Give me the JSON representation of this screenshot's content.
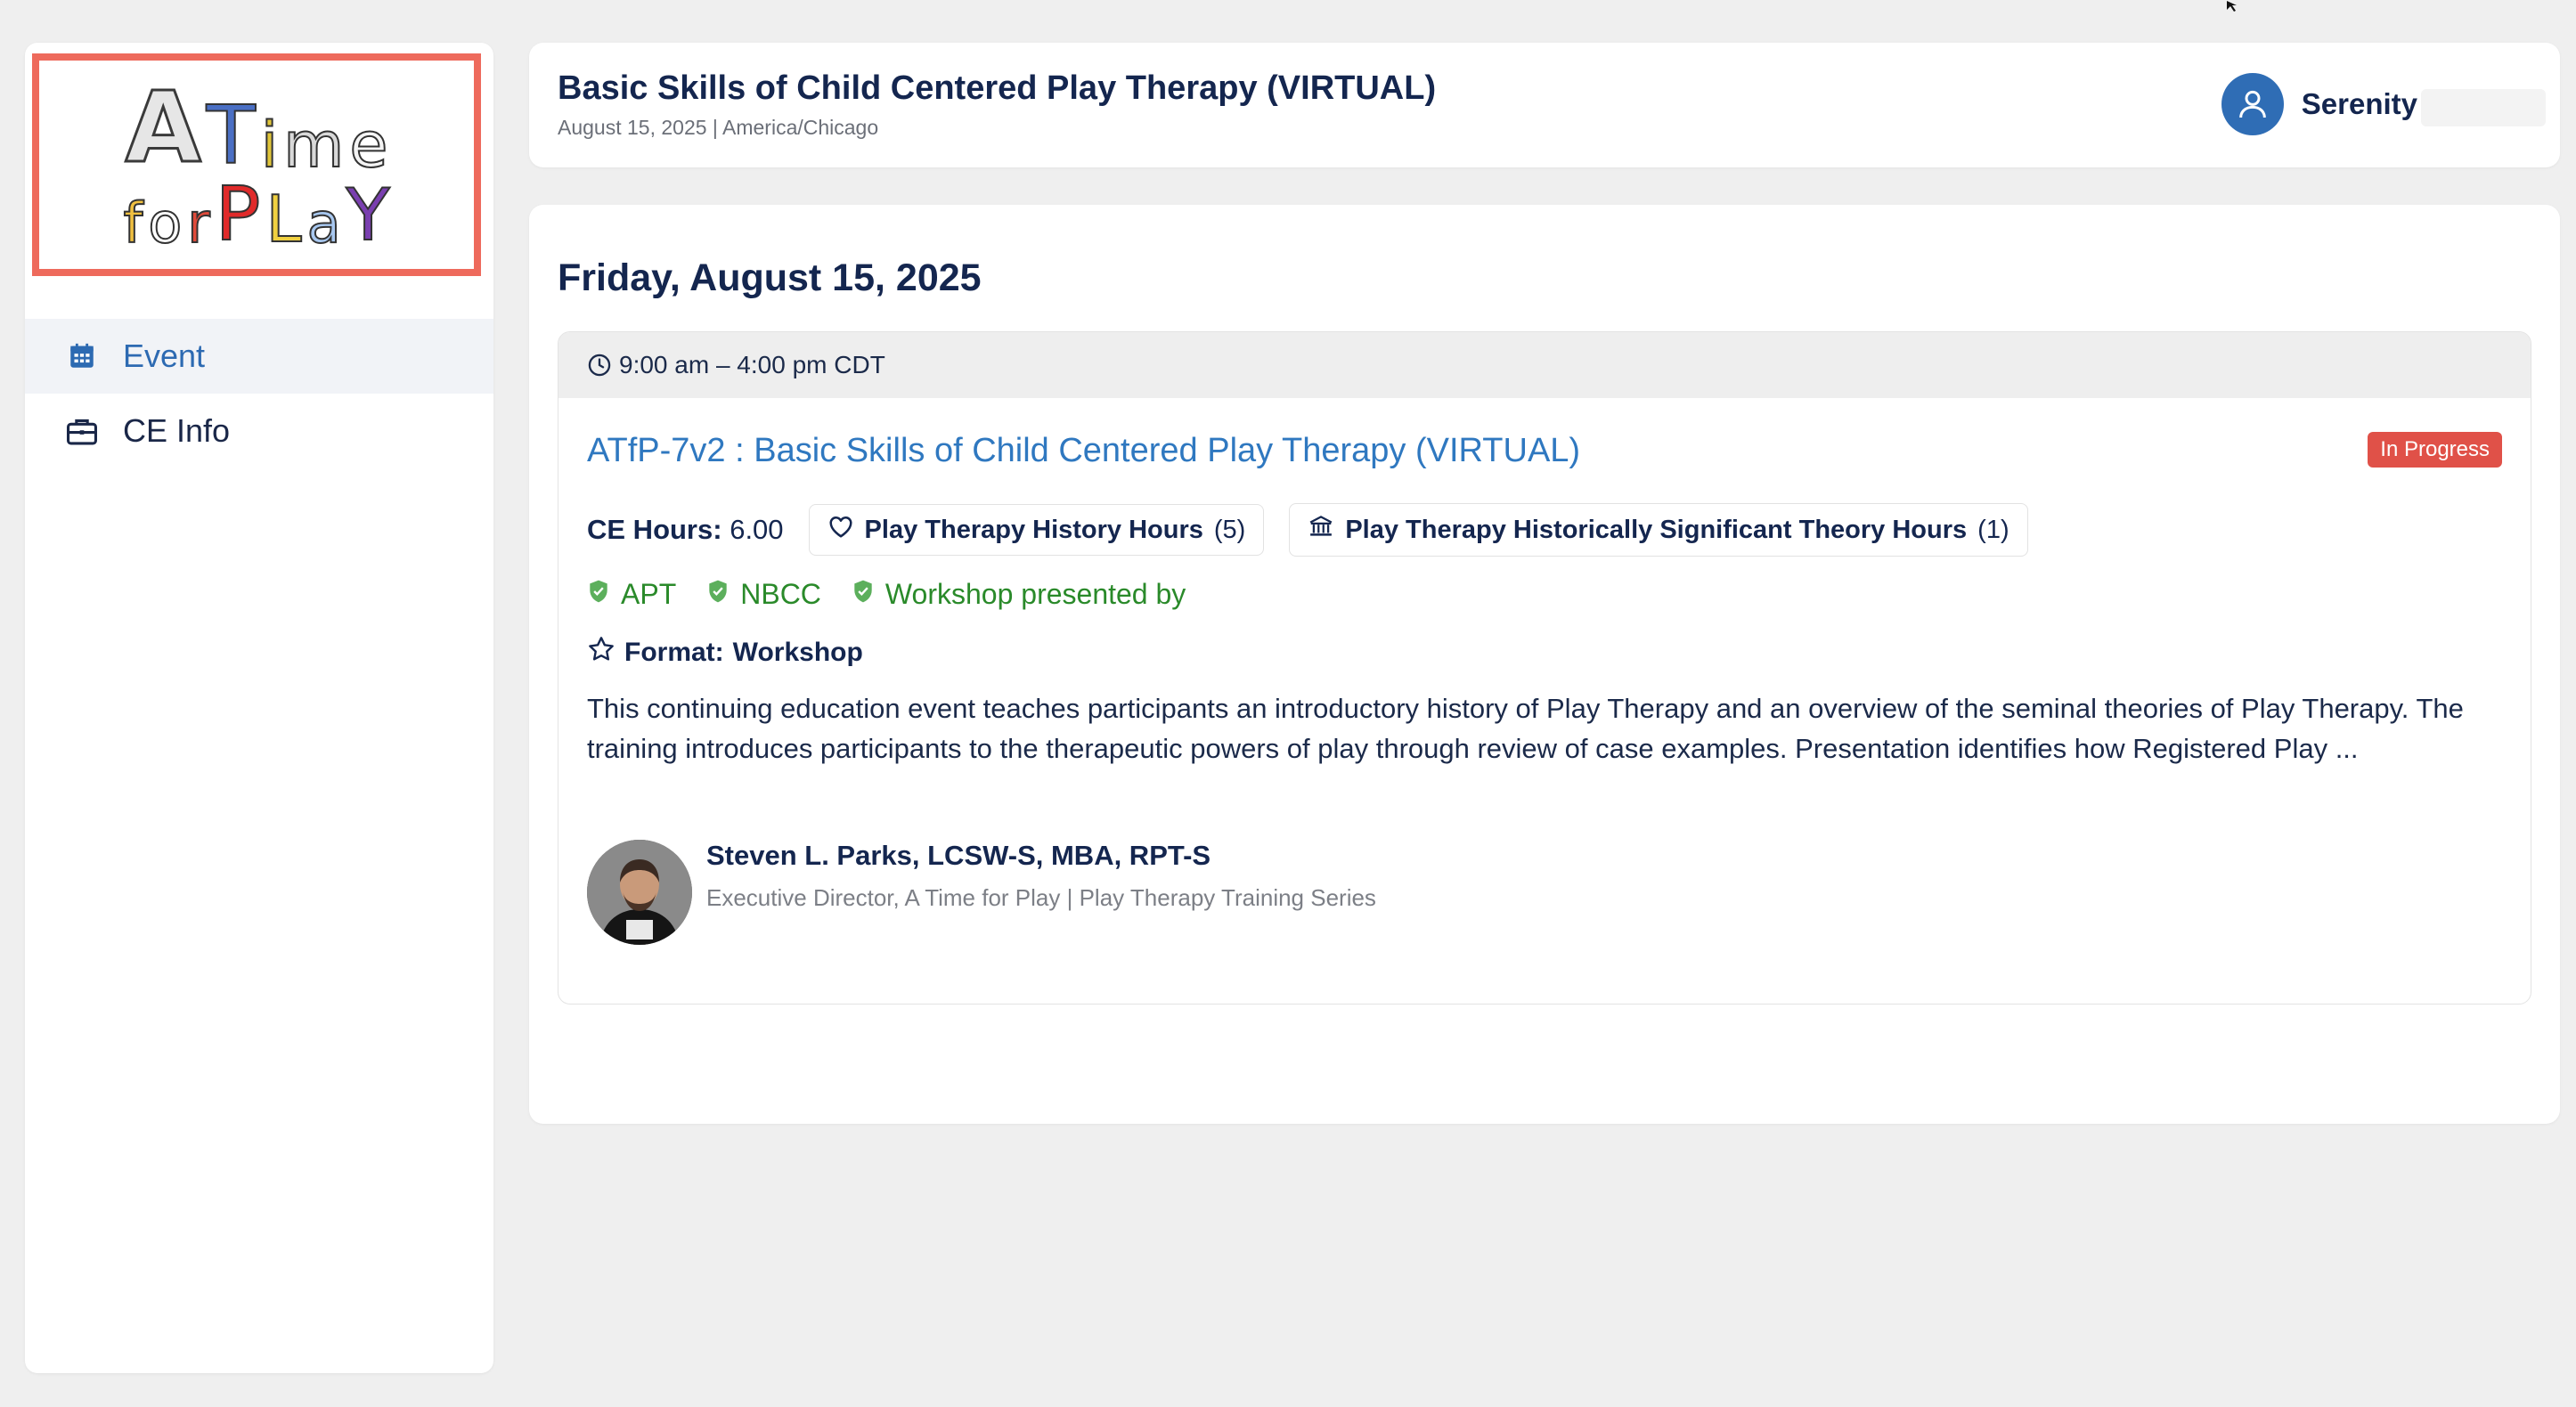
{
  "sidebar": {
    "logo_text": {
      "line1": [
        "A",
        "T",
        "i",
        "m",
        "e"
      ],
      "line2": [
        "f",
        "o",
        "r",
        "P",
        "L",
        "a",
        "Y"
      ]
    },
    "items": [
      {
        "label": "Event",
        "icon": "calendar-icon",
        "active": true
      },
      {
        "label": "CE Info",
        "icon": "briefcase-icon",
        "active": false
      }
    ]
  },
  "header": {
    "title": "Basic Skills of Child Centered Play Therapy (VIRTUAL)",
    "subtitle": "August 15, 2025 | America/Chicago",
    "user_name": "Serenity"
  },
  "main": {
    "date_heading": "Friday, August 15, 2025",
    "session": {
      "time": "9:00 am – 4:00 pm CDT",
      "title": "ATfP-7v2 : Basic Skills of Child Centered Play Therapy (VIRTUAL)",
      "status": "In Progress",
      "ce_label": "CE Hours:",
      "ce_value": "6.00",
      "chips": [
        {
          "label": "Play Therapy History Hours",
          "count": "(5)",
          "icon": "heart-icon"
        },
        {
          "label": "Play Therapy Historically Significant Theory Hours",
          "count": "(1)",
          "icon": "institution-icon"
        }
      ],
      "approvals": [
        "APT",
        "NBCC",
        "Workshop presented by"
      ],
      "format_label": "Format:",
      "format_value": "Workshop",
      "description": "This continuing education event teaches participants an introductory history of Play Therapy and an overview of the seminal theories of Play Therapy. The training introduces participants to the therapeutic powers of play through review of case examples. Presentation identifies how Registered Play ...",
      "presenter": {
        "name": "Steven L. Parks, LCSW-S, MBA, RPT-S",
        "role": "Executive Director, A Time for Play | Play Therapy Training Series"
      }
    }
  },
  "colors": {
    "accent": "#2f78c0",
    "status": "#e05148",
    "approved": "#2a8a2a",
    "logo_border": "#ee6a5c"
  }
}
